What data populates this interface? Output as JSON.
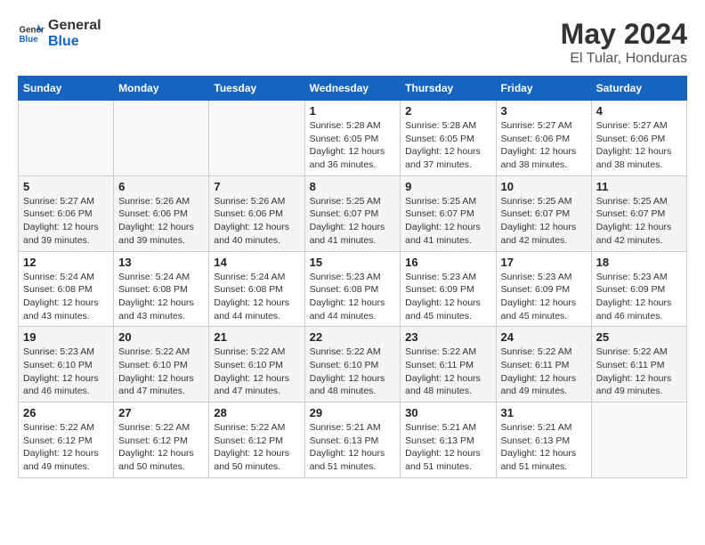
{
  "header": {
    "logo_general": "General",
    "logo_blue": "Blue",
    "month": "May 2024",
    "location": "El Tular, Honduras"
  },
  "days_of_week": [
    "Sunday",
    "Monday",
    "Tuesday",
    "Wednesday",
    "Thursday",
    "Friday",
    "Saturday"
  ],
  "weeks": [
    {
      "days": [
        {
          "num": "",
          "info": ""
        },
        {
          "num": "",
          "info": ""
        },
        {
          "num": "",
          "info": ""
        },
        {
          "num": "1",
          "info": "Sunrise: 5:28 AM\nSunset: 6:05 PM\nDaylight: 12 hours\nand 36 minutes."
        },
        {
          "num": "2",
          "info": "Sunrise: 5:28 AM\nSunset: 6:05 PM\nDaylight: 12 hours\nand 37 minutes."
        },
        {
          "num": "3",
          "info": "Sunrise: 5:27 AM\nSunset: 6:06 PM\nDaylight: 12 hours\nand 38 minutes."
        },
        {
          "num": "4",
          "info": "Sunrise: 5:27 AM\nSunset: 6:06 PM\nDaylight: 12 hours\nand 38 minutes."
        }
      ]
    },
    {
      "days": [
        {
          "num": "5",
          "info": "Sunrise: 5:27 AM\nSunset: 6:06 PM\nDaylight: 12 hours\nand 39 minutes."
        },
        {
          "num": "6",
          "info": "Sunrise: 5:26 AM\nSunset: 6:06 PM\nDaylight: 12 hours\nand 39 minutes."
        },
        {
          "num": "7",
          "info": "Sunrise: 5:26 AM\nSunset: 6:06 PM\nDaylight: 12 hours\nand 40 minutes."
        },
        {
          "num": "8",
          "info": "Sunrise: 5:25 AM\nSunset: 6:07 PM\nDaylight: 12 hours\nand 41 minutes."
        },
        {
          "num": "9",
          "info": "Sunrise: 5:25 AM\nSunset: 6:07 PM\nDaylight: 12 hours\nand 41 minutes."
        },
        {
          "num": "10",
          "info": "Sunrise: 5:25 AM\nSunset: 6:07 PM\nDaylight: 12 hours\nand 42 minutes."
        },
        {
          "num": "11",
          "info": "Sunrise: 5:25 AM\nSunset: 6:07 PM\nDaylight: 12 hours\nand 42 minutes."
        }
      ]
    },
    {
      "days": [
        {
          "num": "12",
          "info": "Sunrise: 5:24 AM\nSunset: 6:08 PM\nDaylight: 12 hours\nand 43 minutes."
        },
        {
          "num": "13",
          "info": "Sunrise: 5:24 AM\nSunset: 6:08 PM\nDaylight: 12 hours\nand 43 minutes."
        },
        {
          "num": "14",
          "info": "Sunrise: 5:24 AM\nSunset: 6:08 PM\nDaylight: 12 hours\nand 44 minutes."
        },
        {
          "num": "15",
          "info": "Sunrise: 5:23 AM\nSunset: 6:08 PM\nDaylight: 12 hours\nand 44 minutes."
        },
        {
          "num": "16",
          "info": "Sunrise: 5:23 AM\nSunset: 6:09 PM\nDaylight: 12 hours\nand 45 minutes."
        },
        {
          "num": "17",
          "info": "Sunrise: 5:23 AM\nSunset: 6:09 PM\nDaylight: 12 hours\nand 45 minutes."
        },
        {
          "num": "18",
          "info": "Sunrise: 5:23 AM\nSunset: 6:09 PM\nDaylight: 12 hours\nand 46 minutes."
        }
      ]
    },
    {
      "days": [
        {
          "num": "19",
          "info": "Sunrise: 5:23 AM\nSunset: 6:10 PM\nDaylight: 12 hours\nand 46 minutes."
        },
        {
          "num": "20",
          "info": "Sunrise: 5:22 AM\nSunset: 6:10 PM\nDaylight: 12 hours\nand 47 minutes."
        },
        {
          "num": "21",
          "info": "Sunrise: 5:22 AM\nSunset: 6:10 PM\nDaylight: 12 hours\nand 47 minutes."
        },
        {
          "num": "22",
          "info": "Sunrise: 5:22 AM\nSunset: 6:10 PM\nDaylight: 12 hours\nand 48 minutes."
        },
        {
          "num": "23",
          "info": "Sunrise: 5:22 AM\nSunset: 6:11 PM\nDaylight: 12 hours\nand 48 minutes."
        },
        {
          "num": "24",
          "info": "Sunrise: 5:22 AM\nSunset: 6:11 PM\nDaylight: 12 hours\nand 49 minutes."
        },
        {
          "num": "25",
          "info": "Sunrise: 5:22 AM\nSunset: 6:11 PM\nDaylight: 12 hours\nand 49 minutes."
        }
      ]
    },
    {
      "days": [
        {
          "num": "26",
          "info": "Sunrise: 5:22 AM\nSunset: 6:12 PM\nDaylight: 12 hours\nand 49 minutes."
        },
        {
          "num": "27",
          "info": "Sunrise: 5:22 AM\nSunset: 6:12 PM\nDaylight: 12 hours\nand 50 minutes."
        },
        {
          "num": "28",
          "info": "Sunrise: 5:22 AM\nSunset: 6:12 PM\nDaylight: 12 hours\nand 50 minutes."
        },
        {
          "num": "29",
          "info": "Sunrise: 5:21 AM\nSunset: 6:13 PM\nDaylight: 12 hours\nand 51 minutes."
        },
        {
          "num": "30",
          "info": "Sunrise: 5:21 AM\nSunset: 6:13 PM\nDaylight: 12 hours\nand 51 minutes."
        },
        {
          "num": "31",
          "info": "Sunrise: 5:21 AM\nSunset: 6:13 PM\nDaylight: 12 hours\nand 51 minutes."
        },
        {
          "num": "",
          "info": ""
        }
      ]
    }
  ]
}
